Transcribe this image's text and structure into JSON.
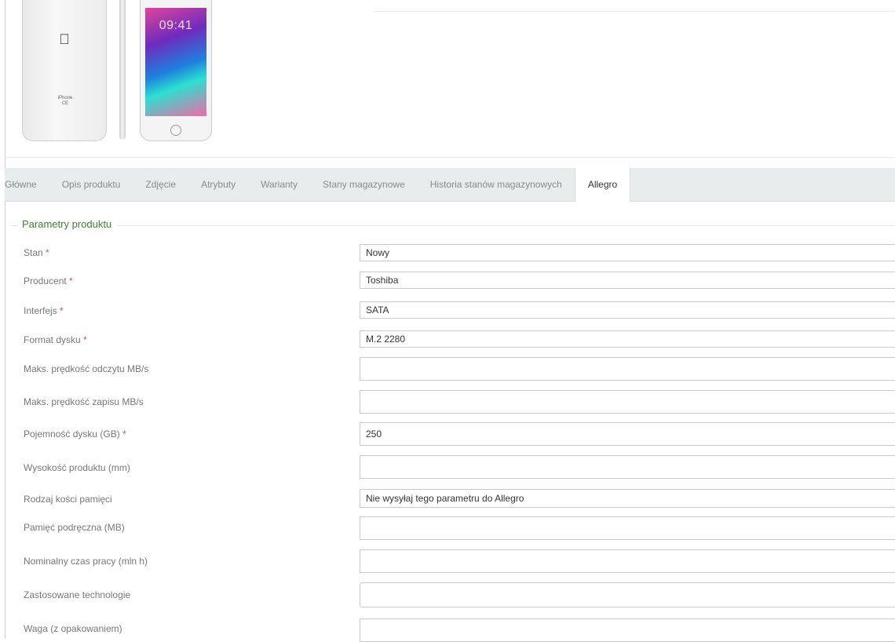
{
  "images": {
    "phone_back_text": "iPhone",
    "phone_back_marks": "CE",
    "phone_time": "09:41"
  },
  "tabs": [
    {
      "label": "Główne"
    },
    {
      "label": "Opis produktu"
    },
    {
      "label": "Zdjęcie"
    },
    {
      "label": "Atrybuty"
    },
    {
      "label": "Warianty"
    },
    {
      "label": "Stany magazynowe"
    },
    {
      "label": "Historia stanów magazynowych"
    },
    {
      "label": "Allegro",
      "active": true
    }
  ],
  "section": {
    "title": "Parametry produktu"
  },
  "fields": [
    {
      "label": "Stan",
      "required": "*",
      "value": "Nowy"
    },
    {
      "label": "Producent",
      "required": "*",
      "value": "Toshiba"
    },
    {
      "label": "Interfejs",
      "required": "*",
      "value": "SATA"
    },
    {
      "label": "Format dysku",
      "required": "*",
      "value": "M.2 2280"
    },
    {
      "label": "Maks. prędkość odczytu MB/s",
      "required": "",
      "value": ""
    },
    {
      "label": "Maks. prędkość zapisu MB/s",
      "required": "",
      "value": ""
    },
    {
      "label": "Pojemność dysku (GB)",
      "required": "*",
      "value": "250"
    },
    {
      "label": "Wysokość produktu (mm)",
      "required": "",
      "value": ""
    },
    {
      "label": "Rodzaj kości pamięci",
      "required": "",
      "value": "Nie wysyłaj tego parametru do Allegro"
    },
    {
      "label": "Pamięć podręczna (MB)",
      "required": "",
      "value": ""
    },
    {
      "label": "Nominalny czas pracy (mln h)",
      "required": "",
      "value": ""
    },
    {
      "label": "Zastosowane technologie",
      "required": "",
      "value": ""
    },
    {
      "label": "Waga (z opakowaniem)",
      "required": "",
      "value": ""
    }
  ]
}
